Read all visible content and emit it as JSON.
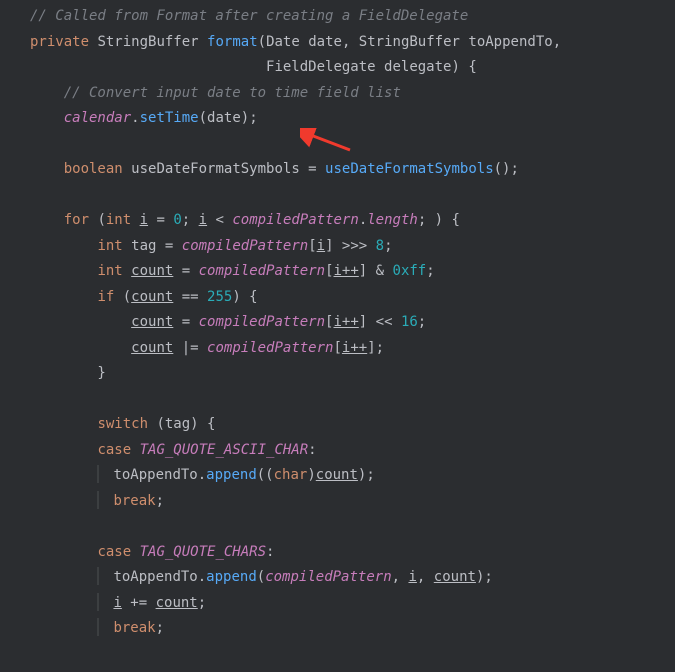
{
  "code": {
    "l1": "// Called from Format after creating a FieldDelegate",
    "priv": "private",
    "sb": "StringBuffer",
    "fmt": "format",
    "date_t": "Date",
    "date_p": "date",
    "sb2": "StringBuffer",
    "toapp": "toAppendTo",
    "fd": "FieldDelegate",
    "deleg": "delegate",
    "l4": "// Convert input date to time field list",
    "cal": "calendar",
    "settime": "setTime",
    "bool": "boolean",
    "usedfs_v": "useDateFormatSymbols",
    "usedfs_m": "useDateFormatSymbols",
    "for": "for",
    "int": "int",
    "i": "i",
    "zero": "0",
    "comp": "compiledPattern",
    "len": "length",
    "tag": "tag",
    "ipp": "i++",
    "eight": "8",
    "count": "count",
    "hex": "0xff",
    "if": "if",
    "n255": "255",
    "sixteen": "16",
    "switch": "switch",
    "case": "case",
    "tqac": "TAG_QUOTE_ASCII_CHAR",
    "append": "append",
    "char": "char",
    "break": "break",
    "tqc": "TAG_QUOTE_CHARS"
  }
}
